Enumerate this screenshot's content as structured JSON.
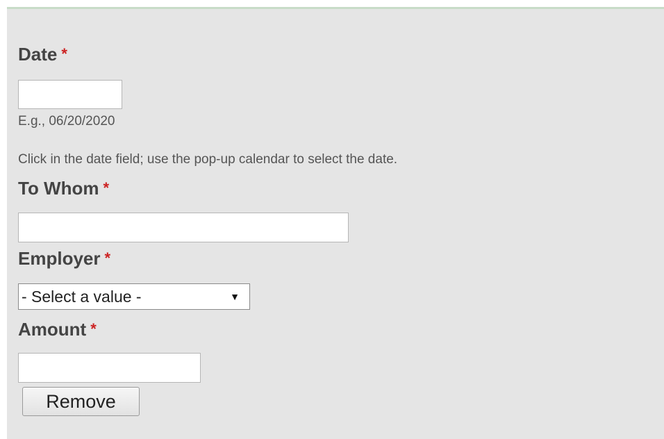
{
  "form": {
    "date": {
      "label": "Date",
      "required_marker": "*",
      "value": "",
      "example": "E.g., 06/20/2020",
      "instructions": "Click in the date field; use the pop-up calendar to select the date."
    },
    "to_whom": {
      "label": "To Whom",
      "required_marker": "*",
      "value": ""
    },
    "employer": {
      "label": "Employer",
      "required_marker": "*",
      "selected": "- Select a value -"
    },
    "amount": {
      "label": "Amount",
      "required_marker": "*",
      "value": ""
    },
    "remove_label": "Remove"
  },
  "colors": {
    "panel_background": "#e5e5e5",
    "required_marker": "#cc2222",
    "label_text": "#444444"
  }
}
